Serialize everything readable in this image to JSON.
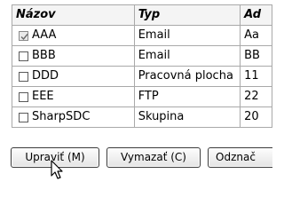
{
  "table": {
    "headers": [
      "Názov",
      "Typ",
      "Ad"
    ],
    "rows": [
      {
        "name": "AAA",
        "type": "Email",
        "addr": "Aa",
        "checked": true
      },
      {
        "name": "BBB",
        "type": "Email",
        "addr": "BB",
        "checked": false
      },
      {
        "name": "DDD",
        "type": "Pracovná plocha",
        "addr": "11",
        "checked": false
      },
      {
        "name": "EEE",
        "type": "FTP",
        "addr": "22",
        "checked": false
      },
      {
        "name": "SharpSDC",
        "type": "Skupina",
        "addr": "20",
        "checked": false
      }
    ]
  },
  "buttons": {
    "edit_label": "Upraviť (M)",
    "delete_label": "Vymazať (C)",
    "more_label": "Odznač"
  },
  "cursor": {
    "icon": "arrow-pointer-icon"
  }
}
